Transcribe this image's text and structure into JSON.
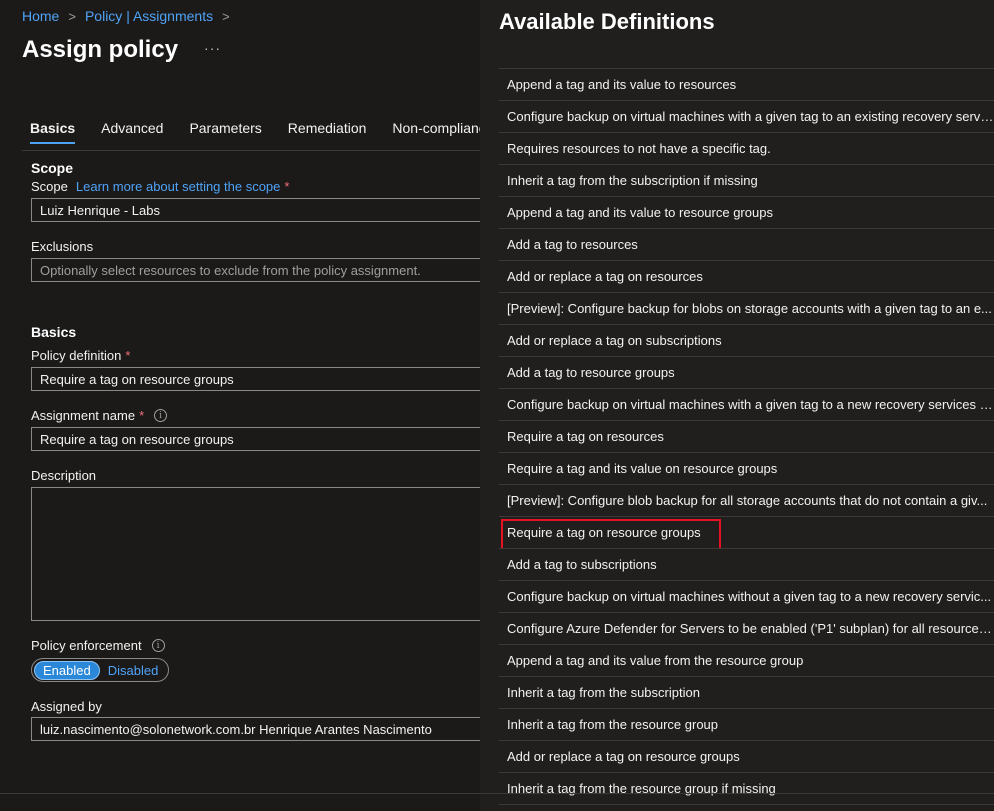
{
  "breadcrumb": [
    {
      "label": "Home"
    },
    {
      "label": "Policy | Assignments"
    }
  ],
  "page": {
    "title": "Assign policy",
    "more_label": "···"
  },
  "tabs": [
    {
      "label": "Basics",
      "active": true
    },
    {
      "label": "Advanced"
    },
    {
      "label": "Parameters"
    },
    {
      "label": "Remediation"
    },
    {
      "label": "Non-compliance"
    }
  ],
  "scope_section": {
    "heading": "Scope",
    "scope_label": "Scope",
    "scope_link": "Learn more about setting the scope",
    "required_mark": "*",
    "scope_value": "Luiz Henrique - Labs",
    "exclusions_label": "Exclusions",
    "exclusions_placeholder": "Optionally select resources to exclude from the policy assignment."
  },
  "basics_section": {
    "heading": "Basics",
    "policy_definition_label": "Policy definition",
    "policy_definition_value": "Require a tag on resource groups",
    "assignment_name_label": "Assignment name",
    "assignment_name_value": "Require a tag on resource groups",
    "info_icon": "i",
    "description_label": "Description",
    "description_value": "",
    "enforcement_label": "Policy enforcement",
    "enforcement_options": [
      "Enabled",
      "Disabled"
    ],
    "enforcement_selected": "Enabled",
    "assigned_by_label": "Assigned by",
    "assigned_by_value": "luiz.nascimento@solonetwork.com.br Henrique Arantes Nascimento"
  },
  "panel": {
    "title": "Available Definitions",
    "highlight_color": "#e81123",
    "definitions": [
      "Append a tag and its value to resources",
      "Configure backup on virtual machines with a given tag to an existing recovery servi...",
      "Requires resources to not have a specific tag.",
      "Inherit a tag from the subscription if missing",
      "Append a tag and its value to resource groups",
      "Add a tag to resources",
      "Add or replace a tag on resources",
      "[Preview]: Configure backup for blobs on storage accounts with a given tag to an e...",
      "Add or replace a tag on subscriptions",
      "Add a tag to resource groups",
      "Configure backup on virtual machines with a given tag to a new recovery services v...",
      "Require a tag on resources",
      "Require a tag and its value on resource groups",
      "[Preview]: Configure blob backup for all storage accounts that do not contain a giv...",
      "Require a tag on resource groups",
      "Add a tag to subscriptions",
      "Configure backup on virtual machines without a given tag to a new recovery servic...",
      "Configure Azure Defender for Servers to be enabled ('P1' subplan) for all resources ...",
      "Append a tag and its value from the resource group",
      "Inherit a tag from the subscription",
      "Inherit a tag from the resource group",
      "Add or replace a tag on resource groups",
      "Inherit a tag from the resource group if missing"
    ],
    "highlighted_index": 14
  }
}
